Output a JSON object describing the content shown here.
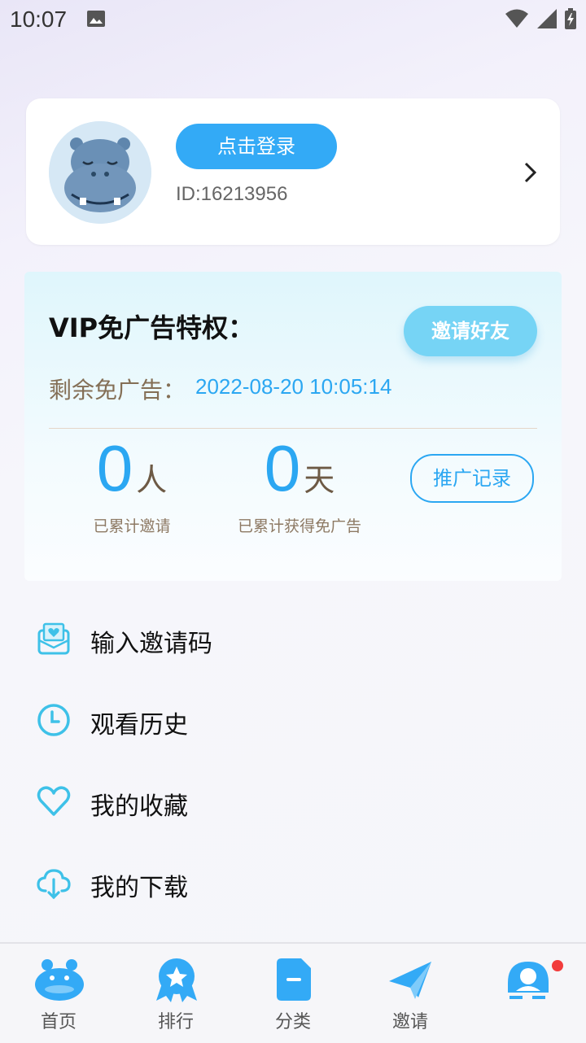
{
  "status_bar": {
    "time": "10:07"
  },
  "profile": {
    "login_label": "点击登录",
    "user_id": "ID:16213956"
  },
  "vip": {
    "title": "VIP免广告特权：",
    "invite_button": "邀请好友",
    "remain_label": "剩余免广告：",
    "remain_value": "2022-08-20 10:05:14",
    "invites": {
      "value": "0",
      "unit": "人",
      "label": "已累计邀请"
    },
    "days": {
      "value": "0",
      "unit": "天",
      "label": "已累计获得免广告"
    },
    "record_button": "推广记录"
  },
  "menu": [
    {
      "label": "输入邀请码",
      "icon": "mail-heart-icon"
    },
    {
      "label": "观看历史",
      "icon": "clock-icon"
    },
    {
      "label": "我的收藏",
      "icon": "heart-icon"
    },
    {
      "label": "我的下载",
      "icon": "cloud-download-icon"
    }
  ],
  "tabs": [
    {
      "label": "首页",
      "icon": "hippo-home-icon"
    },
    {
      "label": "排行",
      "icon": "ranking-badge-icon"
    },
    {
      "label": "分类",
      "icon": "category-icon"
    },
    {
      "label": "邀请",
      "icon": "paper-plane-icon"
    },
    {
      "label": "",
      "icon": "profile-icon",
      "active": true
    }
  ],
  "colors": {
    "accent": "#2ba7f2",
    "button": "#33aaf6",
    "invite": "#76d4f5",
    "brown": "#846f56",
    "badge": "#f23c3c"
  }
}
